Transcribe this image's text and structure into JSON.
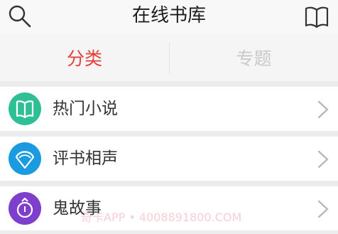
{
  "header": {
    "title": "在线书库",
    "left_icon": "search-icon",
    "right_icon": "open-book-icon"
  },
  "tabs": [
    {
      "label": "分类",
      "active": true
    },
    {
      "label": "专题",
      "active": false
    }
  ],
  "categories": [
    {
      "label": "热门小说",
      "icon": "open-book-icon",
      "color": "#2fbf95"
    },
    {
      "label": "评书相声",
      "icon": "fan-icon",
      "color": "#1a9be0"
    },
    {
      "label": "鬼故事",
      "icon": "lantern-icon",
      "color": "#7d3fcc"
    }
  ],
  "watermark": "奇卡APP • 4008891800.COM",
  "colors": {
    "accent": "#e2413b",
    "inactive_tab": "#c9c9c9",
    "background": "#ececec"
  }
}
